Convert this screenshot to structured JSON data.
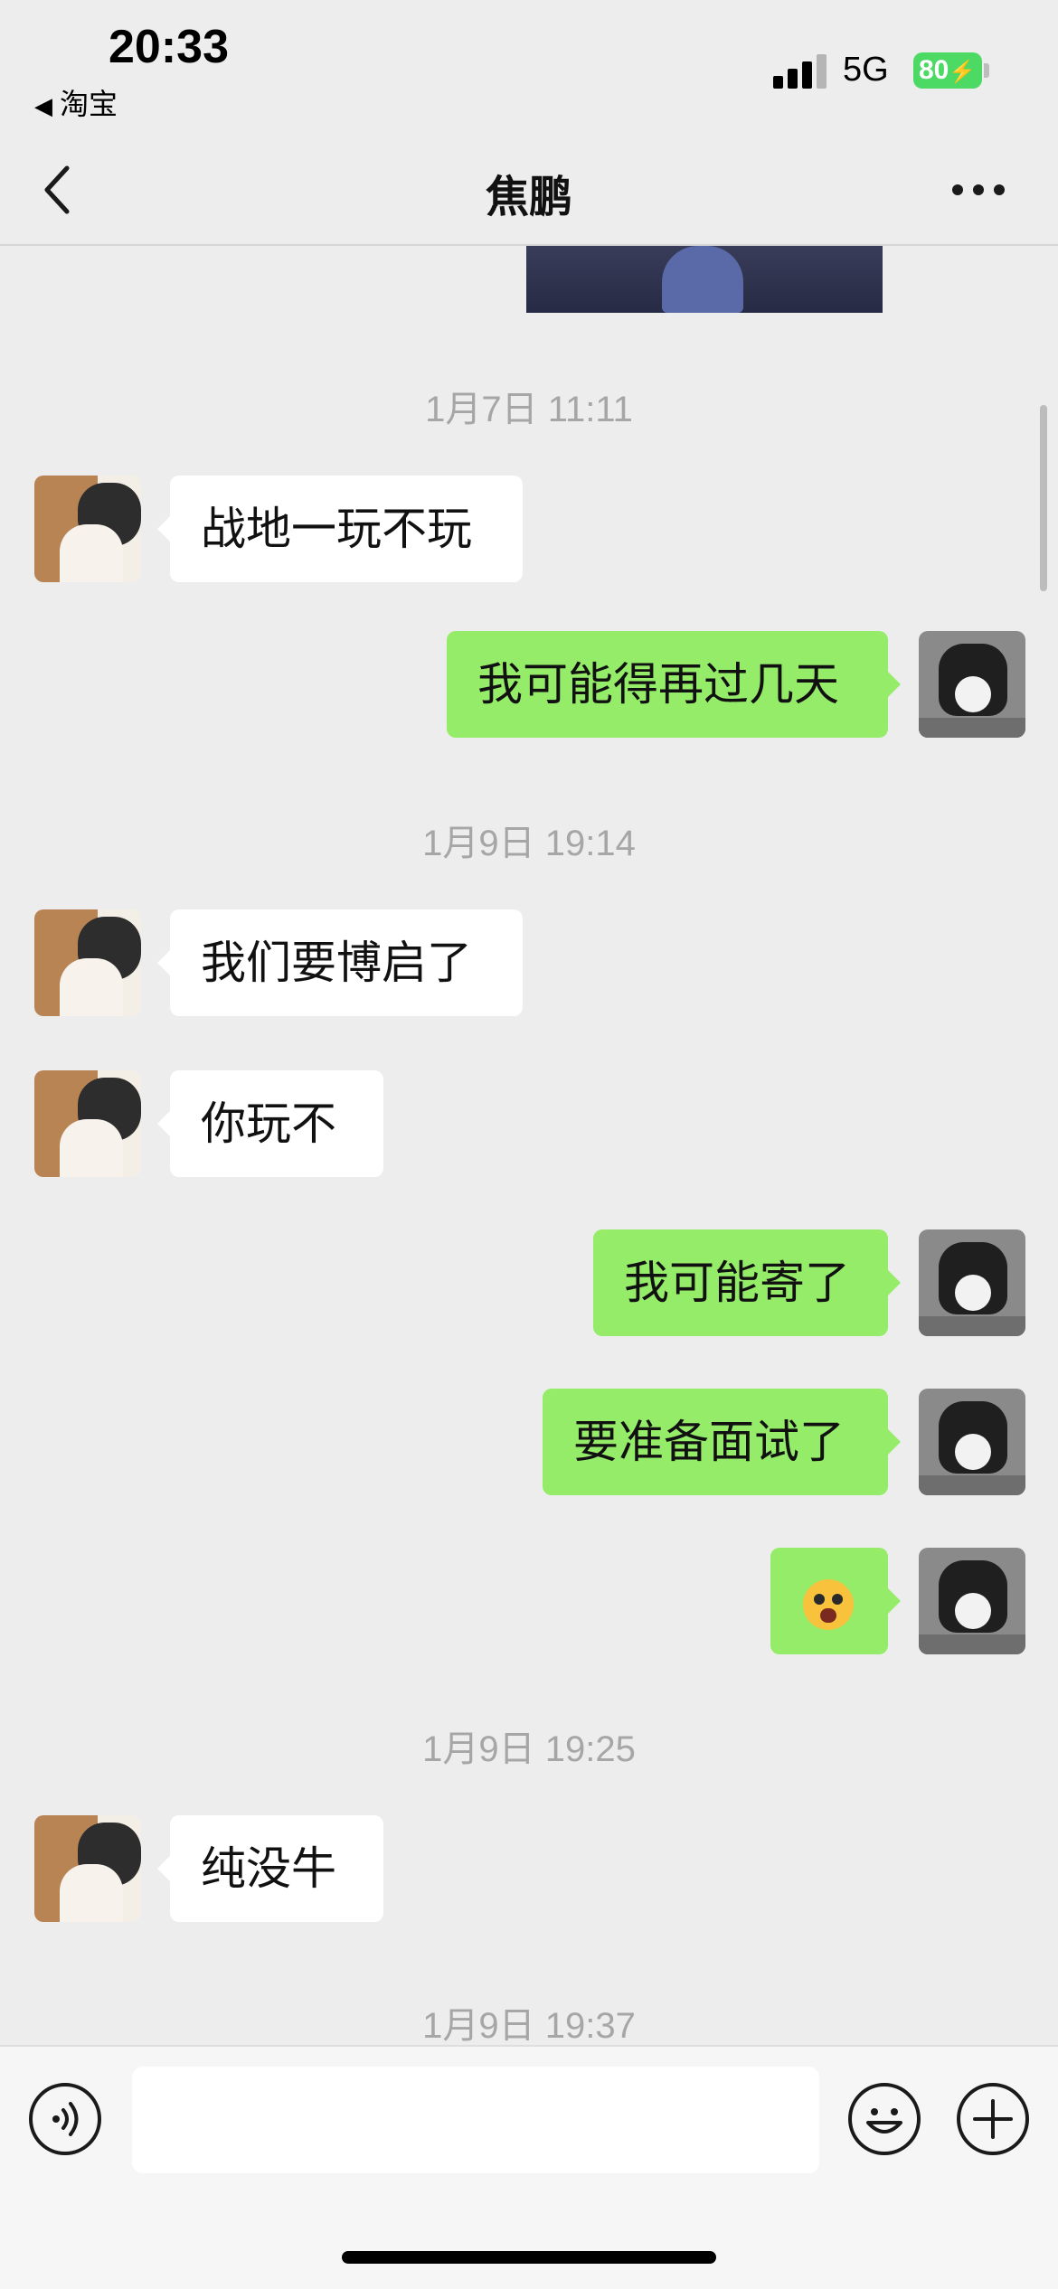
{
  "status_bar": {
    "time": "20:33",
    "back_app": "淘宝",
    "network": "5G",
    "battery": "80"
  },
  "nav": {
    "title": "焦鹏",
    "back_icon": "chevron-left-icon",
    "more_icon": "more-dots-icon"
  },
  "messages": [
    {
      "kind": "timestamp",
      "text": "1月7日 11:11"
    },
    {
      "kind": "message",
      "side": "left",
      "text": "战地一玩不玩"
    },
    {
      "kind": "message",
      "side": "right",
      "text": "我可能得再过几天"
    },
    {
      "kind": "timestamp",
      "text": "1月9日 19:14"
    },
    {
      "kind": "message",
      "side": "left",
      "text": "我们要博启了"
    },
    {
      "kind": "message",
      "side": "left",
      "text": "你玩不"
    },
    {
      "kind": "message",
      "side": "right",
      "text": "我可能寄了"
    },
    {
      "kind": "message",
      "side": "right",
      "text": "要准备面试了"
    },
    {
      "kind": "message",
      "side": "right",
      "emoji": "screaming-face-emoji"
    },
    {
      "kind": "timestamp",
      "text": "1月9日 19:25"
    },
    {
      "kind": "message",
      "side": "left",
      "text": "纯没牛"
    },
    {
      "kind": "timestamp",
      "text": "1月9日 19:37"
    }
  ],
  "input_bar": {
    "voice_icon": "voice-icon",
    "emoji_icon": "emoji-icon",
    "plus_icon": "plus-icon",
    "text_value": ""
  },
  "colors": {
    "background": "#ededed",
    "outgoing_bubble": "#95ec69",
    "incoming_bubble": "#ffffff",
    "timestamp": "#a6a6a6",
    "battery": "#4cd964"
  }
}
